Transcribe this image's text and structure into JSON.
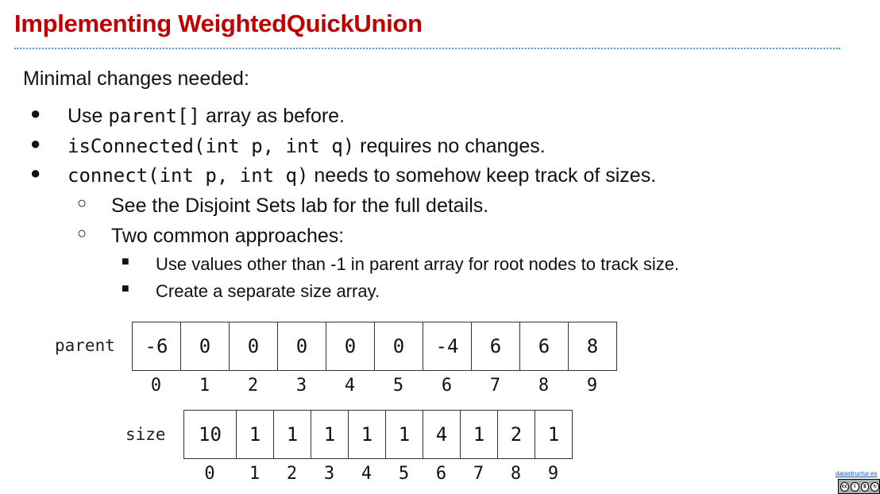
{
  "title": "Implementing WeightedQuickUnion",
  "intro": "Minimal changes needed:",
  "bullets": [
    {
      "code": "",
      "pre": "Use ",
      "code_inline": "parent[]",
      "post": " array as before."
    },
    {
      "code": "isConnected(int p, int q)",
      "text": " requires no changes."
    },
    {
      "code": "connect(int p, int q)",
      "text": " needs to somehow keep track of sizes."
    }
  ],
  "sub_bullets": [
    "See the Disjoint Sets lab for the full details.",
    "Two common approaches:"
  ],
  "sub_sub_bullets": [
    "Use values other than -1 in parent array for root nodes to track size.",
    "Create a separate size array."
  ],
  "parent_array": {
    "label": "parent",
    "values": [
      "-6",
      "0",
      "0",
      "0",
      "0",
      "0",
      "-4",
      "6",
      "6",
      "8"
    ],
    "indices": [
      "0",
      "1",
      "2",
      "3",
      "4",
      "5",
      "6",
      "7",
      "8",
      "9"
    ]
  },
  "size_array": {
    "label": "size",
    "values": [
      "10",
      "1",
      "1",
      "1",
      "1",
      "1",
      "4",
      "1",
      "2",
      "1"
    ],
    "indices": [
      "0",
      "1",
      "2",
      "3",
      "4",
      "5",
      "6",
      "7",
      "8",
      "9"
    ]
  },
  "footer": {
    "link_text": "datastructur.es",
    "license_icons": [
      "cc-icon",
      "by-icon",
      "nc-icon",
      "sa-icon"
    ]
  }
}
